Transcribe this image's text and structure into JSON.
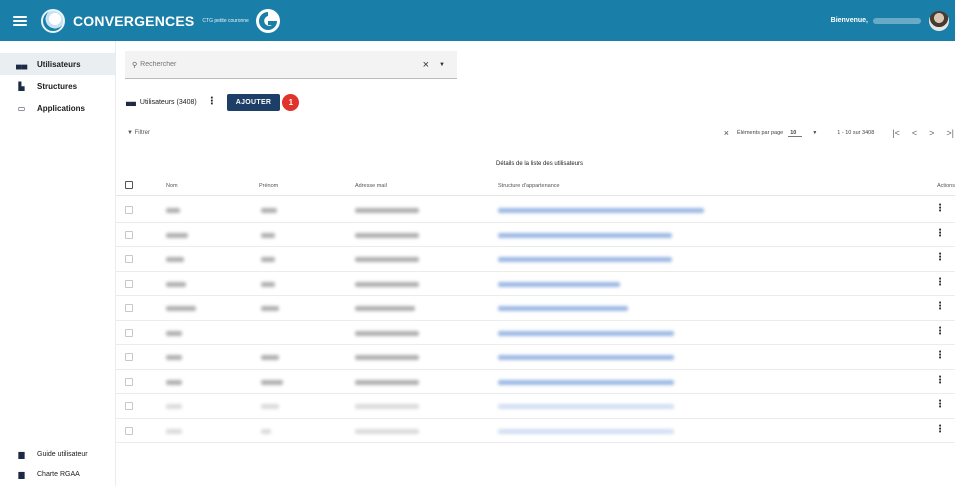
{
  "header": {
    "title": "CONVERGENCES",
    "subtitle": "CTG petite couronne",
    "welcome": "Bienvenue,",
    "menu_icon": "hamburger-icon",
    "brand_color": "#1a7fa8"
  },
  "sidebar": {
    "items": [
      {
        "label": "Utilisateurs",
        "icon": "users-icon",
        "active": true
      },
      {
        "label": "Structures",
        "icon": "building-icon",
        "active": false
      },
      {
        "label": "Applications",
        "icon": "window-icon",
        "active": false
      }
    ],
    "bottom": [
      {
        "label": "Guide utilisateur",
        "icon": "book-icon"
      },
      {
        "label": "Charte RGAA",
        "icon": "document-icon"
      }
    ]
  },
  "search": {
    "placeholder": "Rechercher"
  },
  "users_bar": {
    "label": "Utilisateurs (3408)",
    "add_label": "AJOUTER",
    "badge": "1",
    "accent_color": "#1d3e66",
    "badge_color": "#e0332b"
  },
  "filter": {
    "label": "Filtrer"
  },
  "pager": {
    "per_page_label": "Éléments par page",
    "per_page_value": "10",
    "range": "1 - 10 sur 3408",
    "first": "|<",
    "prev": "<",
    "next": ">",
    "last": ">|"
  },
  "table": {
    "caption": "Détails de la liste des utilisateurs",
    "headers": {
      "nom": "Nom",
      "prenom": "Prénom",
      "mail": "Adresse mail",
      "structure": "Structure d'appartenance",
      "actions": "Actions"
    }
  }
}
